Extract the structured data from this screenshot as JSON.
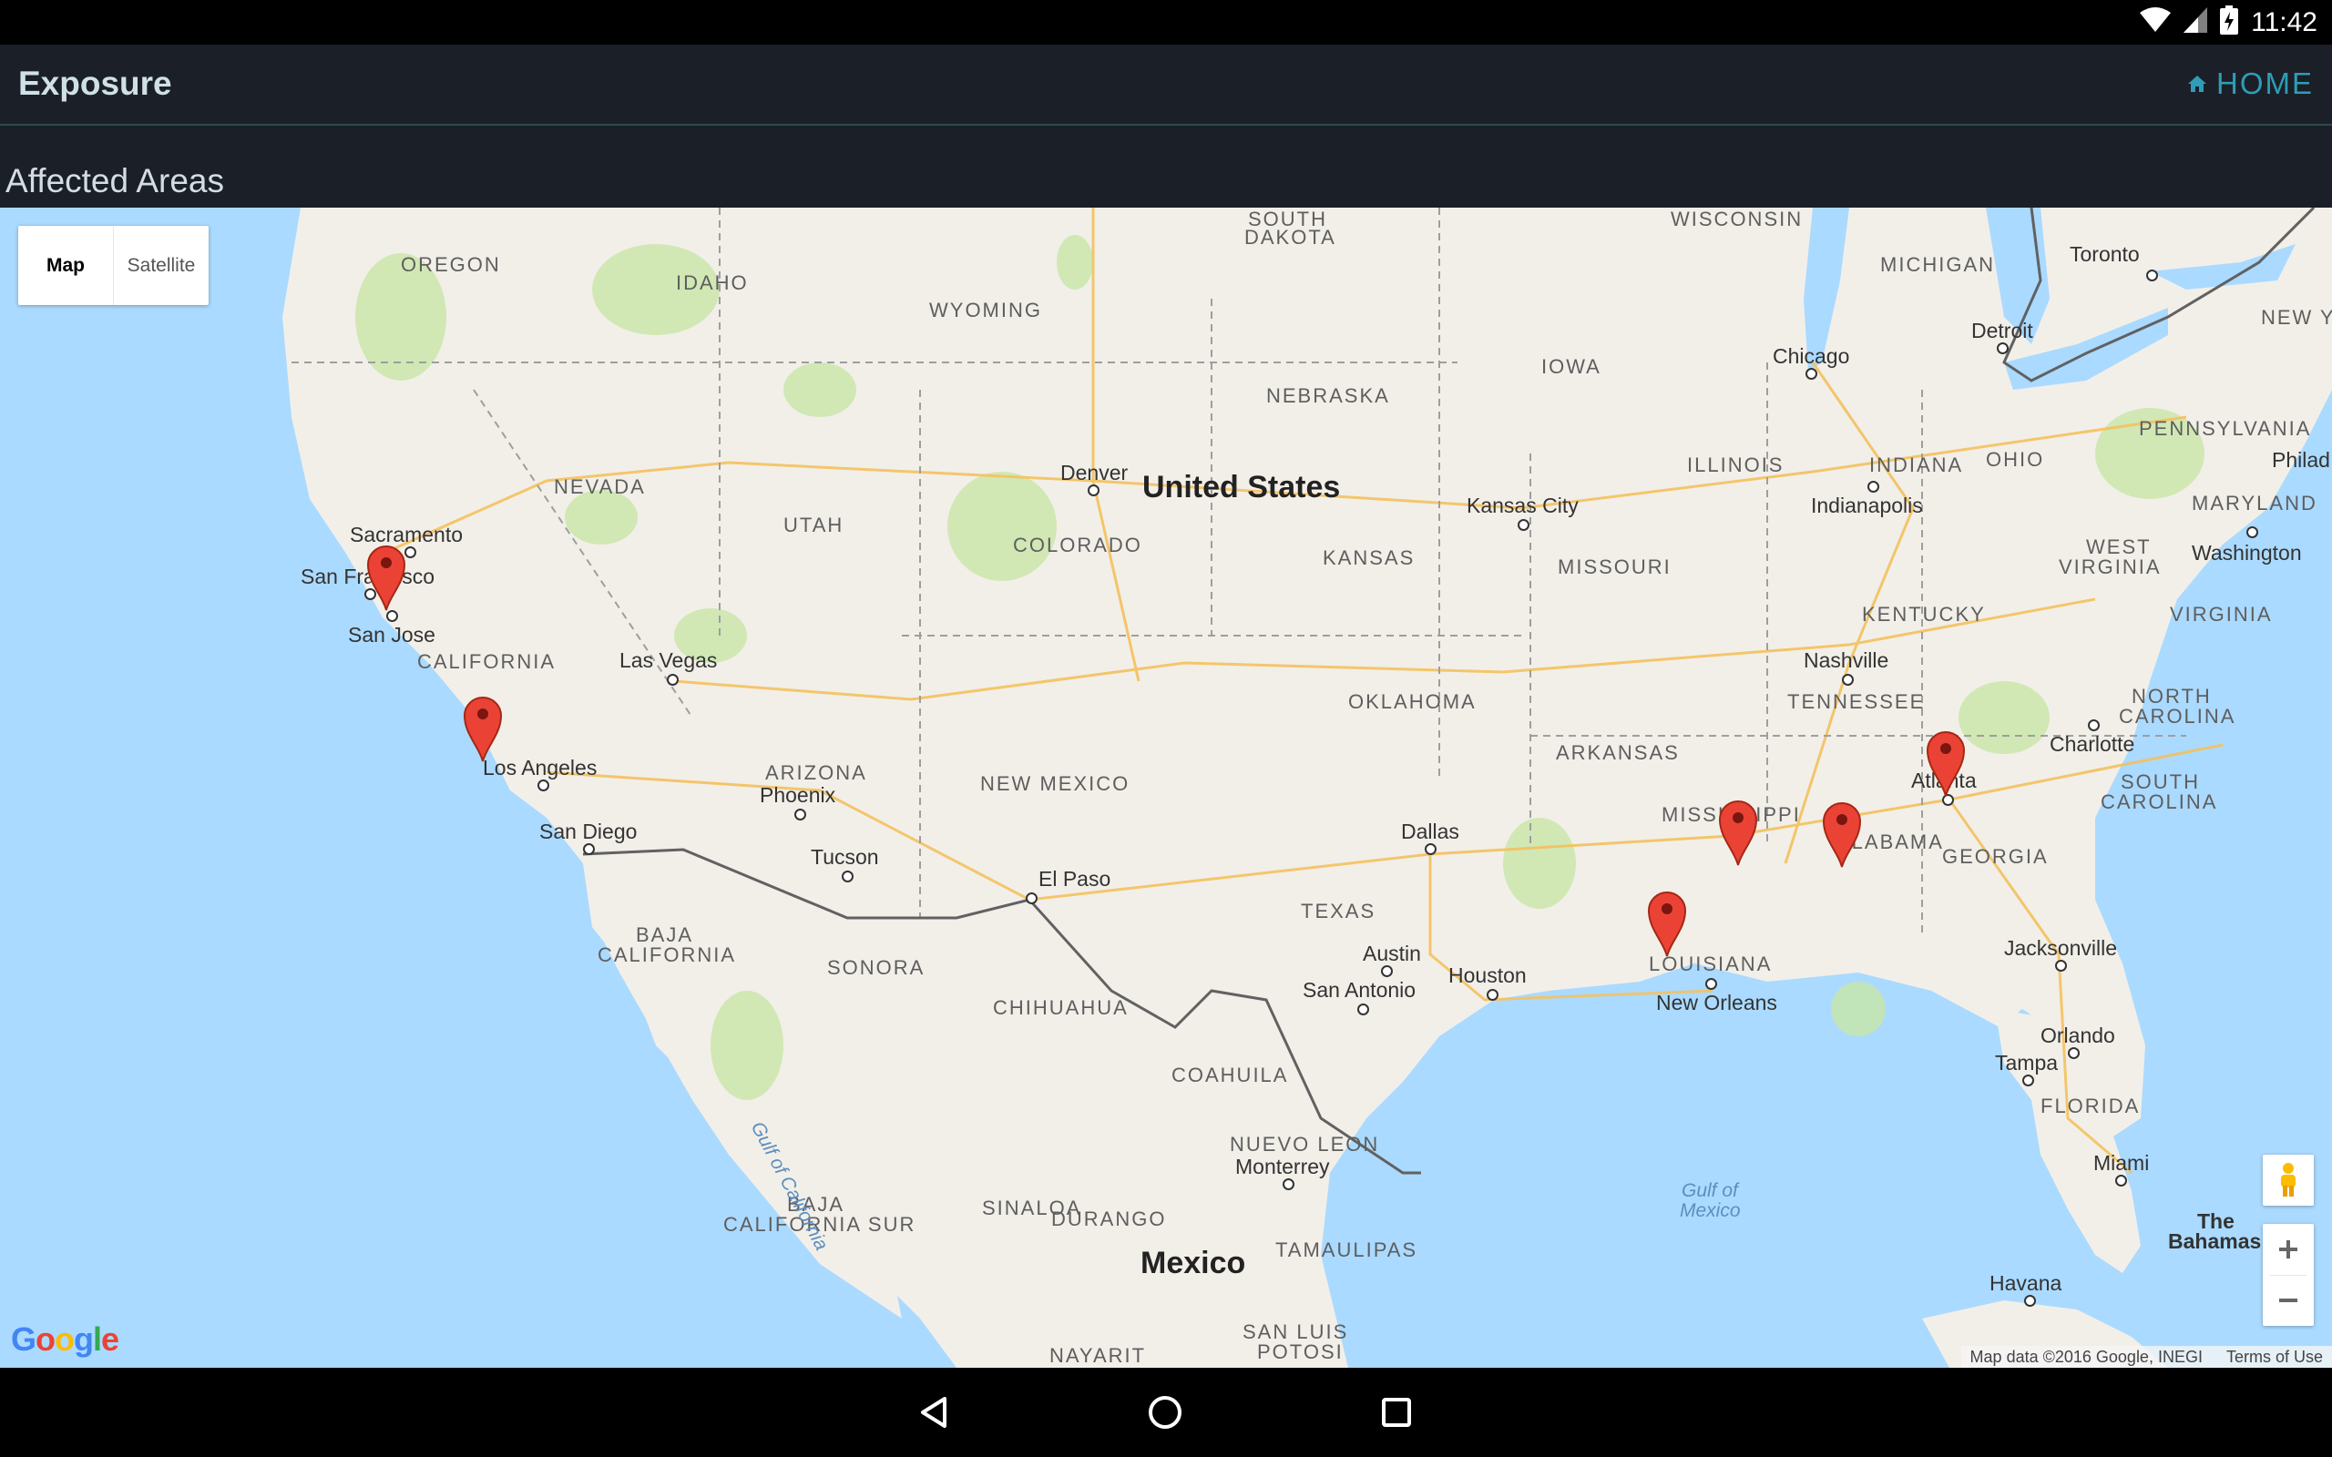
{
  "status": {
    "time": "11:42"
  },
  "app": {
    "title": "Exposure",
    "home_label": "HOME"
  },
  "section": {
    "title": "Affected Areas"
  },
  "map": {
    "type_control": {
      "map": "Map",
      "satellite": "Satellite",
      "selected": "Map"
    },
    "labels": {
      "country_us": "United States",
      "country_mx": "Mexico",
      "oregon": "OREGON",
      "idaho": "IDAHO",
      "wyoming": "WYOMING",
      "south_dakota_1": "SOUTH",
      "south_dakota_2": "DAKOTA",
      "wisconsin": "WISCONSIN",
      "michigan": "MICHIGAN",
      "nebraska": "NEBRASKA",
      "iowa": "IOWA",
      "nevada": "NEVADA",
      "utah": "UTAH",
      "colorado": "COLORADO",
      "kansas": "KANSAS",
      "missouri": "MISSOURI",
      "illinois": "ILLINOIS",
      "indiana": "INDIANA",
      "ohio": "OHIO",
      "pennsylvania": "PENNSYLVANIA",
      "new_york": "NEW YOR",
      "maryland": "MARYLAND",
      "west_virginia_1": "WEST",
      "west_virginia_2": "VIRGINIA",
      "virginia": "VIRGINIA",
      "kentucky": "KENTUCKY",
      "tennessee": "TENNESSEE",
      "north_carolina_1": "NORTH",
      "north_carolina_2": "CAROLINA",
      "south_carolina_1": "SOUTH",
      "south_carolina_2": "CAROLINA",
      "california": "CALIFORNIA",
      "arizona": "ARIZONA",
      "new_mexico": "NEW MEXICO",
      "oklahoma": "OKLAHOMA",
      "arkansas": "ARKANSAS",
      "mississippi": "MISSISSIPPI",
      "alabama": "ALABAMA",
      "georgia": "GEORGIA",
      "louisiana": "LOUISIANA",
      "texas": "TEXAS",
      "florida": "FLORIDA",
      "baja_california_1": "BAJA",
      "baja_california_2": "CALIFORNIA",
      "sonora": "SONORA",
      "chihuahua": "CHIHUAHUA",
      "coahuila": "COAHUILA",
      "nuevo_leon": "NUEVO LEON",
      "sinaloa": "SINALOA",
      "durango": "DURANGO",
      "tamaulipas": "TAMAULIPAS",
      "baja_sur_1": "BAJA",
      "baja_sur_2": "CALIFORNIA SUR",
      "san_luis_1": "SAN LUIS",
      "san_luis_2": "POTOSI",
      "nayarit": "NAYARIT",
      "gulf_ca": "Gulf of California",
      "gulf_mx_1": "Gulf of",
      "gulf_mx_2": "Mexico",
      "bahamas_1": "The",
      "bahamas_2": "Bahamas"
    },
    "cities": {
      "toronto": "Toronto",
      "detroit": "Detroit",
      "chicago": "Chicago",
      "philadelphia": "Philad",
      "washington": "Washington",
      "indianapolis": "Indianapolis",
      "kansas_city": "Kansas City",
      "denver": "Denver",
      "sacramento": "Sacramento",
      "san_francisco": "San Francisco",
      "san_jose": "San Jose",
      "las_vegas": "Las Vegas",
      "los_angeles": "Los Angeles",
      "san_diego": "San Diego",
      "phoenix": "Phoenix",
      "tucson": "Tucson",
      "el_paso": "El Paso",
      "nashville": "Nashville",
      "charlotte": "Charlotte",
      "atlanta": "Atlanta",
      "dallas": "Dallas",
      "austin": "Austin",
      "san_antonio": "San Antonio",
      "houston": "Houston",
      "new_orleans": "New Orleans",
      "jacksonville": "Jacksonville",
      "orlando": "Orlando",
      "tampa": "Tampa",
      "miami": "Miami",
      "monterrey": "Monterrey",
      "havana": "Havana"
    },
    "markers": [
      "San Francisco",
      "Los Angeles",
      "Louisiana",
      "Mississippi",
      "Alabama",
      "Atlanta"
    ],
    "marker_color": "#ea4335",
    "attribution": "Map data ©2016 Google, INEGI",
    "terms": "Terms of Use",
    "google_logo": "Google"
  },
  "colors": {
    "app_bar": "#1b1f27",
    "accent": "#2e9db5",
    "water": "#aadaff",
    "land": "#f2efe9"
  }
}
